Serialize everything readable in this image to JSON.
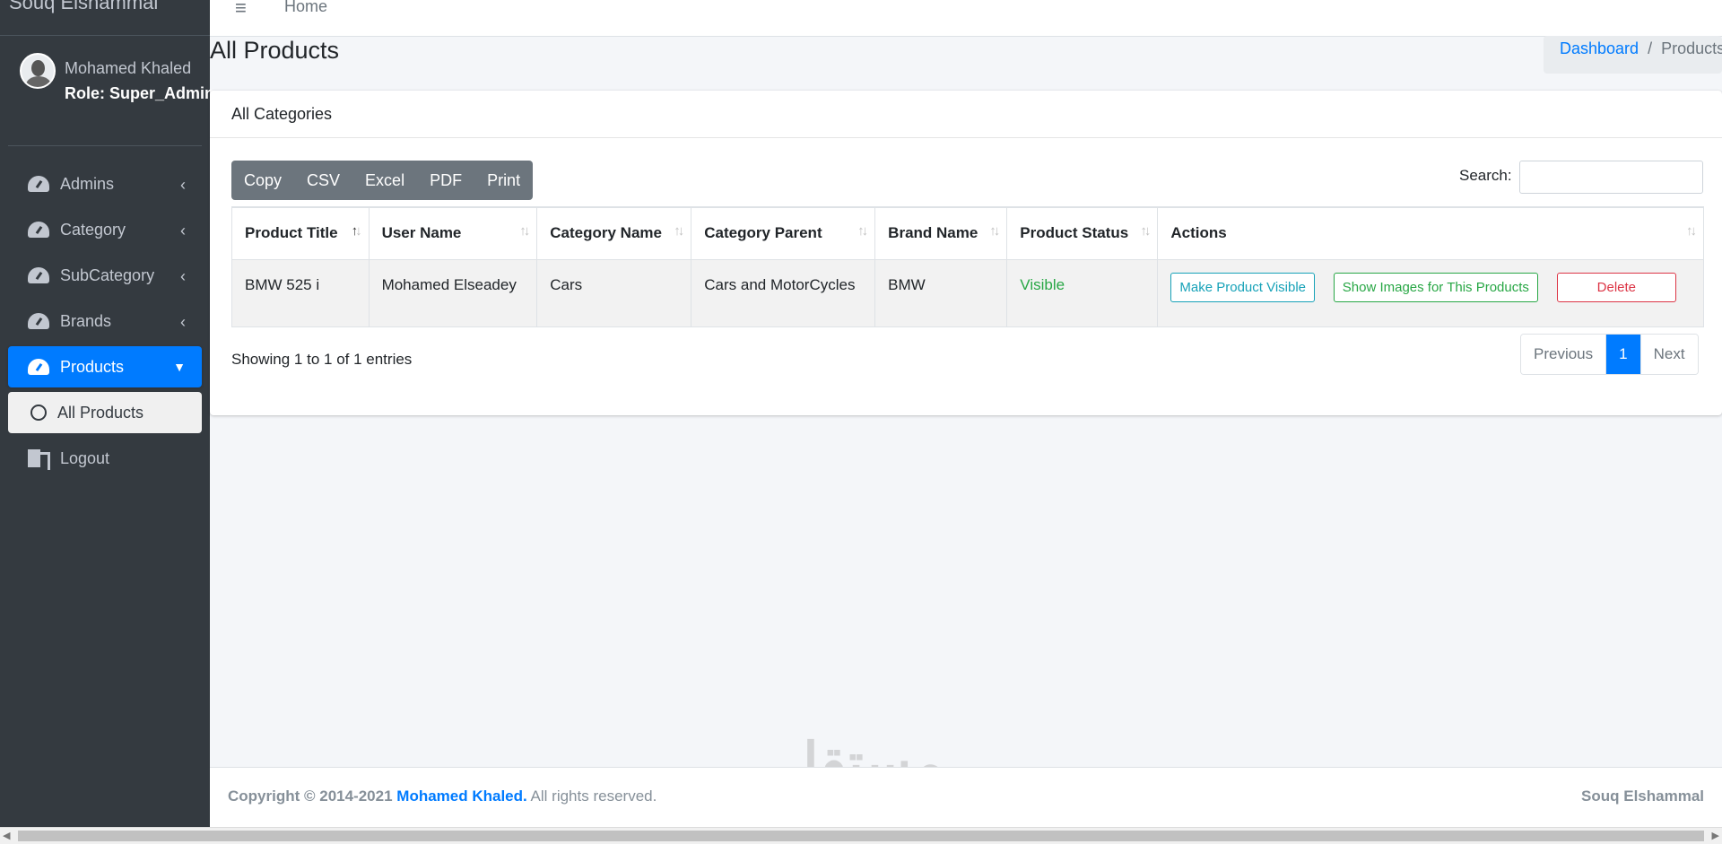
{
  "sidebar": {
    "brand": "Souq Elshammal",
    "user_name": "Mohamed Khaled",
    "user_role": "Role: Super_Admin",
    "items": [
      {
        "label": "Admins",
        "icon": "tachometer-icon"
      },
      {
        "label": "Category",
        "icon": "tachometer-icon"
      },
      {
        "label": "SubCategory",
        "icon": "tachometer-icon"
      },
      {
        "label": "Brands",
        "icon": "tachometer-icon"
      },
      {
        "label": "Products",
        "icon": "tachometer-icon",
        "active": true
      },
      {
        "label": "All Products",
        "icon": "circle-icon",
        "sub": true
      },
      {
        "label": "Logout",
        "icon": "door-icon"
      }
    ]
  },
  "topbar": {
    "home": "Home"
  },
  "header": {
    "title": "All Products",
    "breadcrumb_link": "Dashboard",
    "breadcrumb_sep": "/",
    "breadcrumb_current": "Products"
  },
  "card": {
    "title": "All Categories",
    "buttons": [
      "Copy",
      "CSV",
      "Excel",
      "PDF",
      "Print"
    ],
    "search_label": "Search:",
    "search_value": ""
  },
  "table": {
    "columns": [
      "Product Title",
      "User Name",
      "Category Name",
      "Category Parent",
      "Brand Name",
      "Product Status",
      "Actions"
    ],
    "rows": [
      {
        "product_title": "BMW 525 i",
        "user_name": "Mohamed Elseadey",
        "category_name": "Cars",
        "category_parent": "Cars and MotorCycles",
        "brand_name": "BMW",
        "status": "Visible",
        "actions": [
          "Make Product Visible",
          "Show Images for This Products",
          "Delete"
        ]
      }
    ]
  },
  "footer_info": {
    "entries": "Showing 1 to 1 of 1 entries",
    "prev": "Previous",
    "page": "1",
    "next": "Next"
  },
  "footer": {
    "copyright": "Copyright © 2014-2021",
    "author": "Mohamed Khaled.",
    "rights": "All rights reserved.",
    "brand": "Souq Elshammal"
  },
  "watermark": {
    "arabic": "مستقل",
    "latin": "mostaql.com"
  },
  "colors": {
    "sidebar_bg": "#343a40",
    "accent": "#007bff",
    "success": "#28a745",
    "danger": "#dc3545",
    "info": "#17a2b8"
  }
}
